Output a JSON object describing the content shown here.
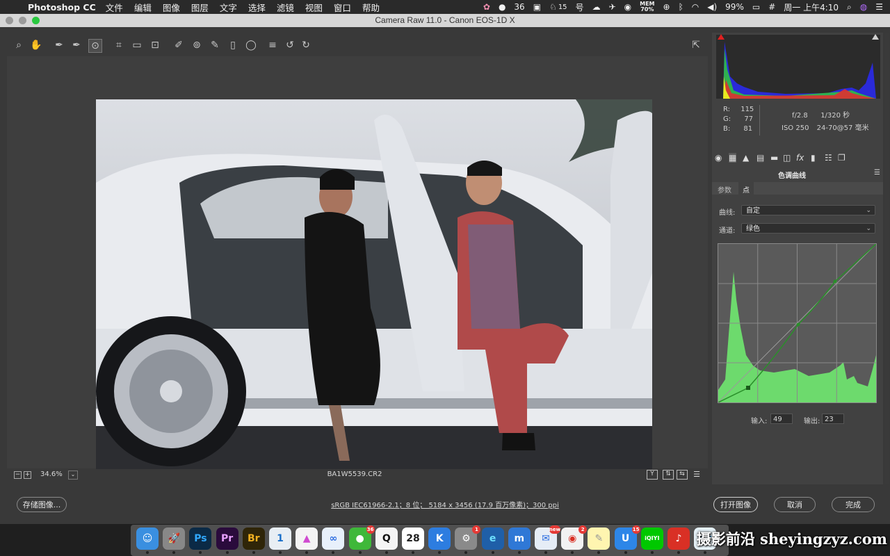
{
  "menubar": {
    "app_name": "Photoshop CC",
    "menus": [
      "文件",
      "编辑",
      "图像",
      "图层",
      "文字",
      "选择",
      "滤镜",
      "视图",
      "窗口",
      "帮助"
    ],
    "wechat_count": "36",
    "app15_count": "15",
    "mem_label": "MEM",
    "mem_value": "70%",
    "battery": "99%",
    "clock": "周一 上午4:10"
  },
  "window": {
    "title": "Camera Raw 11.0 -  Canon EOS-1D X"
  },
  "toolbar": {
    "tools": [
      "zoom-icon",
      "hand-icon",
      "white-balance-icon",
      "color-sampler-icon",
      "targeted-adjustment-icon",
      "crop-icon",
      "straighten-icon",
      "transform-icon",
      "spot-removal-icon",
      "red-eye-icon",
      "adjustment-brush-icon",
      "graduated-filter-icon",
      "radial-filter-icon",
      "preferences-icon",
      "rotate-ccw-icon",
      "rotate-cw-icon"
    ]
  },
  "preview": {
    "zoom": "34.6%",
    "filename": "BA1W5539.CR2"
  },
  "info": {
    "r_label": "R:",
    "r": "115",
    "g_label": "G:",
    "g": "77",
    "b_label": "B:",
    "b": "81",
    "aperture": "f/2.8",
    "shutter": "1/320 秒",
    "iso": "ISO 250",
    "lens": "24-70@57 毫米"
  },
  "panel": {
    "title": "色调曲线",
    "tabs": [
      "参数",
      "点"
    ],
    "curve_label": "曲线:",
    "curve_value": "自定",
    "channel_label": "通道:",
    "channel_value": "绿色",
    "input_label": "输入:",
    "input_value": "49",
    "output_label": "输出:",
    "output_value": "23"
  },
  "bottom": {
    "save_label": "存储图像...",
    "workflow": "sRGB IEC61966-2.1；8 位；  5184 x 3456 (17.9 百万像素)；300 ppi",
    "open_label": "打开图像",
    "cancel_label": "取消",
    "done_label": "完成"
  },
  "dock": {
    "apps": [
      {
        "name": "finder",
        "label": "☺",
        "bg": "#3a8fe0",
        "color": "#fff"
      },
      {
        "name": "launchpad",
        "label": "🚀",
        "bg": "#888",
        "color": "#fff"
      },
      {
        "name": "photoshop",
        "label": "Ps",
        "bg": "#0b2a46",
        "color": "#31a8ff"
      },
      {
        "name": "premiere",
        "label": "Pr",
        "bg": "#2a0b3c",
        "color": "#e8a0ff"
      },
      {
        "name": "bridge",
        "label": "Br",
        "bg": "#2f2508",
        "color": "#f0b020"
      },
      {
        "name": "1password",
        "label": "1",
        "bg": "#e8eef4",
        "color": "#1a6fc9"
      },
      {
        "name": "prism",
        "label": "▲",
        "bg": "#f4f4f4",
        "color": "#d04ad0"
      },
      {
        "name": "baidu-netdisk",
        "label": "∞",
        "bg": "#e8f0fb",
        "color": "#2a6be0"
      },
      {
        "name": "wechat",
        "label": "●",
        "bg": "#3fb83a",
        "color": "#fff",
        "badge": "36"
      },
      {
        "name": "qq",
        "label": "Q",
        "bg": "#f5f5f5",
        "color": "#111"
      },
      {
        "name": "calendar",
        "label": "28",
        "bg": "#fff",
        "color": "#222"
      },
      {
        "name": "kuaiya",
        "label": "K",
        "bg": "#2d7de0",
        "color": "#fff"
      },
      {
        "name": "system-preferences",
        "label": "⚙",
        "bg": "#8a8a8a",
        "color": "#fff",
        "badge": "1"
      },
      {
        "name": "edge",
        "label": "e",
        "bg": "#1f5fa8",
        "color": "#6de0ff"
      },
      {
        "name": "maxthon",
        "label": "m",
        "bg": "#2f78d6",
        "color": "#fff"
      },
      {
        "name": "mail-new",
        "label": "✉",
        "bg": "#e6edf6",
        "color": "#2a6be0",
        "badge": "new"
      },
      {
        "name": "chrome",
        "label": "◉",
        "bg": "#f2f2f2",
        "color": "#d93025",
        "badge": "2"
      },
      {
        "name": "notes",
        "label": "✎",
        "bg": "#fff5b0",
        "color": "#999"
      },
      {
        "name": "u-app",
        "label": "U",
        "bg": "#2d86e8",
        "color": "#fff",
        "badge": "15"
      },
      {
        "name": "iqiyi",
        "label": "iQIYI",
        "bg": "#00c800",
        "color": "#fff"
      },
      {
        "name": "netease-music",
        "label": "♪",
        "bg": "#d93025",
        "color": "#fff"
      },
      {
        "name": "ev-app",
        "label": "ev",
        "bg": "#e6f2f8",
        "color": "#3a9ad8"
      }
    ]
  },
  "watermark": "摄影前沿 sheyingzyz.com"
}
